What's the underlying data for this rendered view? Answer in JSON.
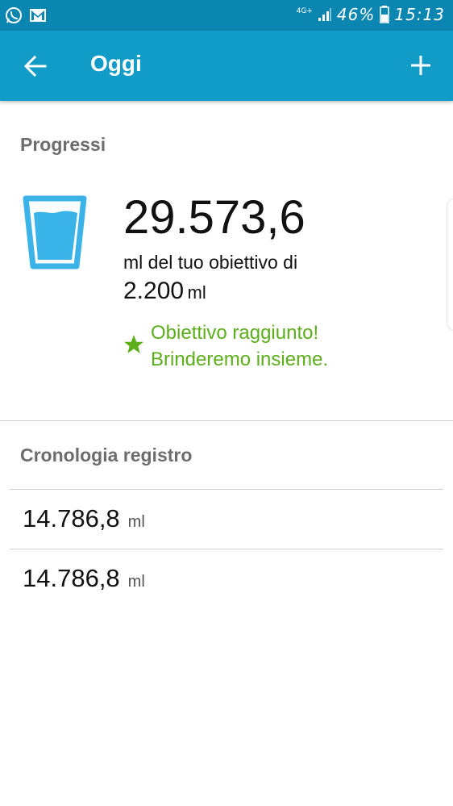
{
  "status_bar": {
    "network": "4G+",
    "battery": "46%",
    "time": "15:13"
  },
  "app_bar": {
    "title": "Oggi"
  },
  "progress": {
    "section_title": "Progressi",
    "amount": "29.573,6",
    "goal_text": "ml del tuo obiettivo di",
    "goal_amount": "2.200",
    "goal_unit": "ml",
    "achieved_line1": "Obiettivo raggiunto!",
    "achieved_line2": "Brinderemo insieme.",
    "glass_color": "#39b3e8",
    "achieved_color": "#5cae1b"
  },
  "log": {
    "section_title": "Cronologia registro",
    "entries": [
      {
        "value": "14.786,8",
        "unit": "ml"
      },
      {
        "value": "14.786,8",
        "unit": "ml"
      }
    ]
  }
}
